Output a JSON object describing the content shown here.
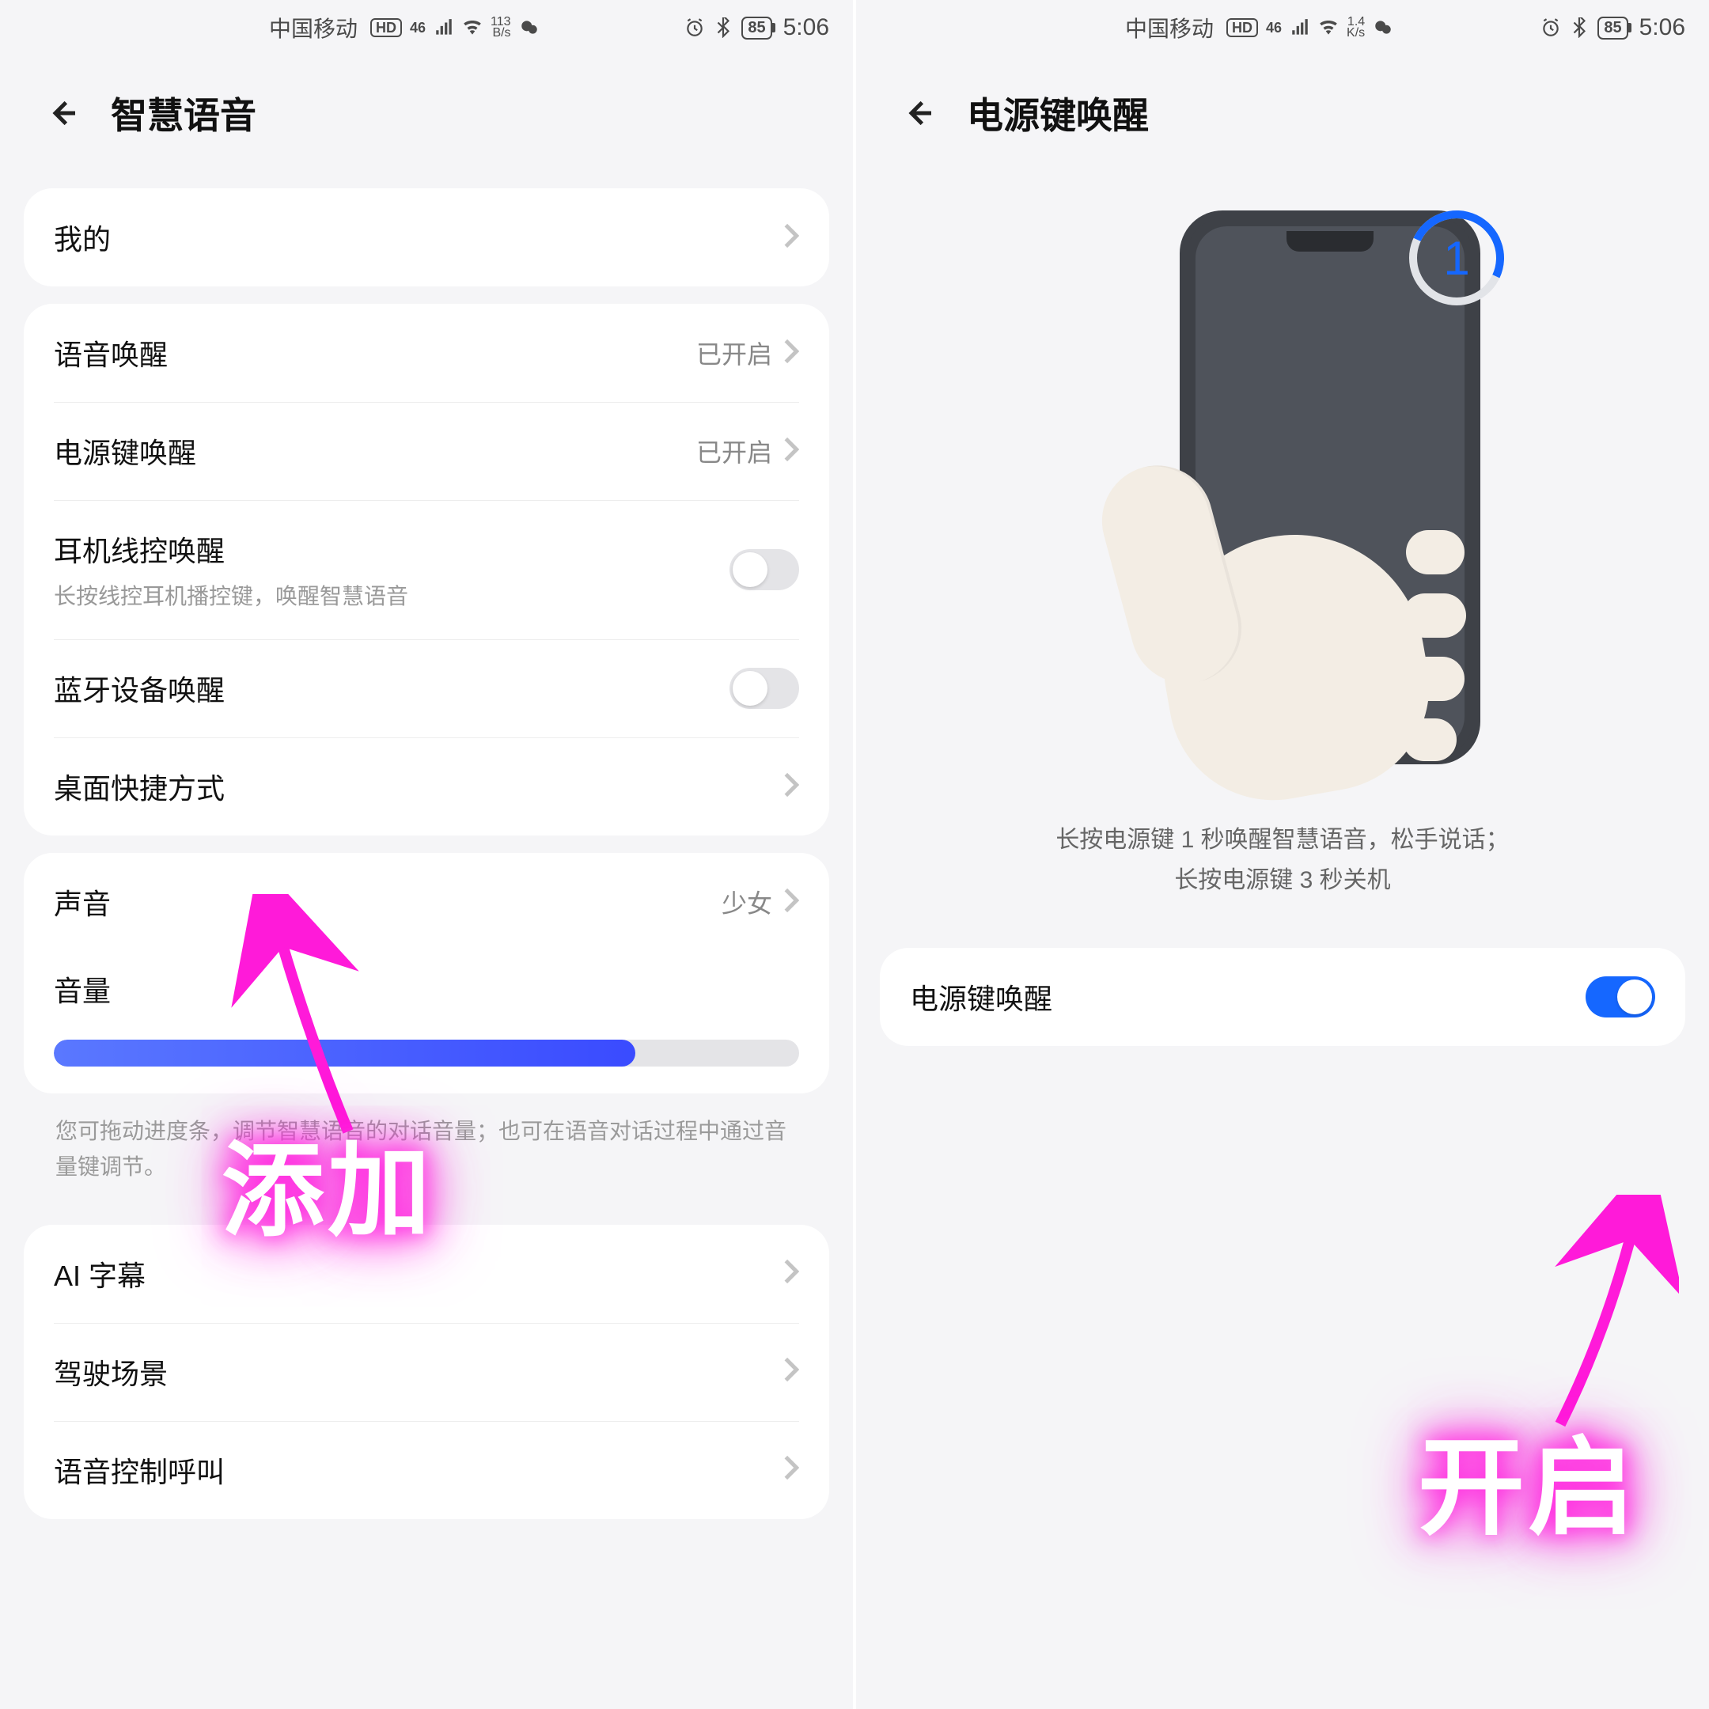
{
  "status_bar": {
    "carrier": "中国移动",
    "hd": "HD",
    "signal_tag": "46",
    "rate_left": {
      "top": "113",
      "bottom": "B/s"
    },
    "rate_right": {
      "top": "1.4",
      "bottom": "K/s"
    },
    "battery": "85",
    "time": "5:06"
  },
  "left": {
    "title": "智慧语音",
    "group1": [
      {
        "label": "我的"
      }
    ],
    "group2": [
      {
        "label": "语音唤醒",
        "value": "已开启",
        "chevron": true
      },
      {
        "label": "电源键唤醒",
        "value": "已开启",
        "chevron": true
      },
      {
        "label": "耳机线控唤醒",
        "sub": "长按线控耳机播控键，唤醒智慧语音",
        "toggle": false
      },
      {
        "label": "蓝牙设备唤醒",
        "toggle": false
      },
      {
        "label": "桌面快捷方式",
        "chevron": true
      }
    ],
    "group3": {
      "voice_label": "声音",
      "voice_value": "少女",
      "volume_label": "音量",
      "volume_percent": 78
    },
    "hint": "您可拖动进度条，调节智慧语音的对话音量；也可在语音对话过程中通过音量键调节。",
    "group4": [
      {
        "label": "AI 字幕"
      },
      {
        "label": "驾驶场景"
      },
      {
        "label": "语音控制呼叫"
      }
    ]
  },
  "right": {
    "title": "电源键唤醒",
    "step": "1",
    "caption_line1": "长按电源键 1 秒唤醒智慧语音，松手说话；",
    "caption_line2": "长按电源键 3 秒关机",
    "toggle_label": "电源键唤醒",
    "toggle_on": true
  },
  "annotations": {
    "left_label": "添加",
    "right_label": "开启"
  }
}
